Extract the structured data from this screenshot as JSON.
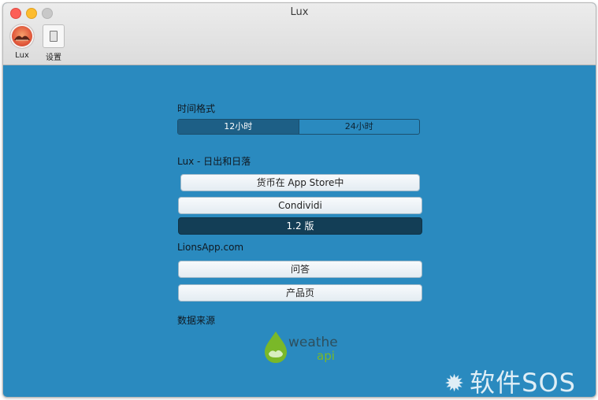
{
  "window": {
    "title": "Lux"
  },
  "toolbar": {
    "items": [
      {
        "label": "Lux",
        "icon": "lux-sunset-icon"
      },
      {
        "label": "设置",
        "icon": "settings-switch-icon"
      }
    ]
  },
  "time_format": {
    "label": "时间格式",
    "options": [
      "12小时",
      "24小时"
    ],
    "selected": "12小时"
  },
  "lux_section": {
    "label": "Lux - 日出和日落",
    "buttons": [
      "货币在 App Store中",
      "Condividi"
    ],
    "version": "1.2 版"
  },
  "lions_section": {
    "label": "LionsApp.com",
    "buttons": [
      "问答",
      "产品页"
    ]
  },
  "data_source": {
    "label": "数据来源",
    "logo_word1": "weather",
    "logo_word2": "api"
  },
  "watermark": {
    "text": "软件SOS"
  },
  "colors": {
    "background": "#2a8abf",
    "segment_active": "#1d5f86",
    "version_button": "#133e56",
    "logo_green": "#7ab828",
    "logo_dark": "#2d4f5e"
  }
}
